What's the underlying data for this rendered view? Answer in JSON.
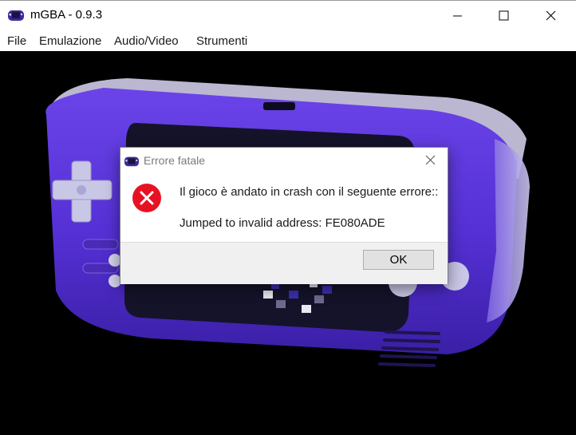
{
  "window": {
    "title": "mGBA - 0.9.3",
    "icon": "gba-handheld-icon",
    "controls": [
      "minimize-icon",
      "maximize-icon",
      "close-icon"
    ]
  },
  "menu": {
    "items": [
      {
        "label": "File"
      },
      {
        "label": "Emulazione"
      },
      {
        "label": "Audio/Video"
      },
      {
        "label": "Strumenti"
      }
    ]
  },
  "canvas": {
    "background": "#000000",
    "device_color": "#5b2fd6",
    "device_accent": "#c9c7e6"
  },
  "dialog": {
    "title": "Errore fatale",
    "icon": "error-x-icon",
    "message_line1": "Il gioco è andato in crash con il seguente errore::",
    "message_line2": "Jumped to invalid address: FE080ADE",
    "ok_label": "OK",
    "error_color": "#e81123"
  }
}
